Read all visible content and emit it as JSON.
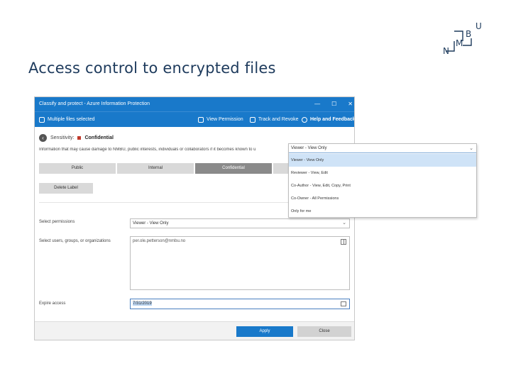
{
  "slide": {
    "title": "Access control to encrypted files",
    "logo_letters": [
      "U",
      "B",
      "M",
      "N"
    ]
  },
  "window": {
    "title": "Classify and protect - Azure Information Protection",
    "controls": [
      "—",
      "☐",
      "✕"
    ]
  },
  "toolbar": {
    "selection_label": "Multiple files selected",
    "view_permission": "View Permission",
    "track_revoke": "Track and Revoke",
    "help_feedback": "Help and Feedback"
  },
  "sensitivity": {
    "label": "Sensitivity:",
    "value": "Confidential"
  },
  "description": "Information that may cause damage to NMBU, public interests, individuals or collaborators if it becomes known to u",
  "label_tabs": [
    {
      "label": "Public",
      "active": false
    },
    {
      "label": "Internal",
      "active": false
    },
    {
      "label": "Confidential",
      "active": true
    },
    {
      "label": "",
      "active": false
    }
  ],
  "delete_label_button": "Delete Label",
  "permissions": {
    "select_label": "Select permissions",
    "selected_value": "Viewer - View Only",
    "users_label": "Select users, groups, or organizations",
    "users_value": "per.ole.petterson@nmbu.no",
    "expire_label": "Expire access",
    "expire_value": "7/31/2019"
  },
  "dropdown": {
    "current": "Viewer - View Only",
    "options": [
      {
        "label": "Viewer - View Only",
        "selected": true
      },
      {
        "label": "Reviewer - View, Edit",
        "selected": false
      },
      {
        "label": "Co-Author - View, Edit, Copy, Print",
        "selected": false
      },
      {
        "label": "Co-Owner - All Permissions",
        "selected": false
      },
      {
        "label": "Only for me",
        "selected": false
      }
    ]
  },
  "buttons": {
    "apply": "Apply",
    "close": "Close"
  },
  "colors": {
    "accent": "#1979ca",
    "title_text": "#1d3a5c",
    "sensitivity_marker": "#c0392b"
  }
}
